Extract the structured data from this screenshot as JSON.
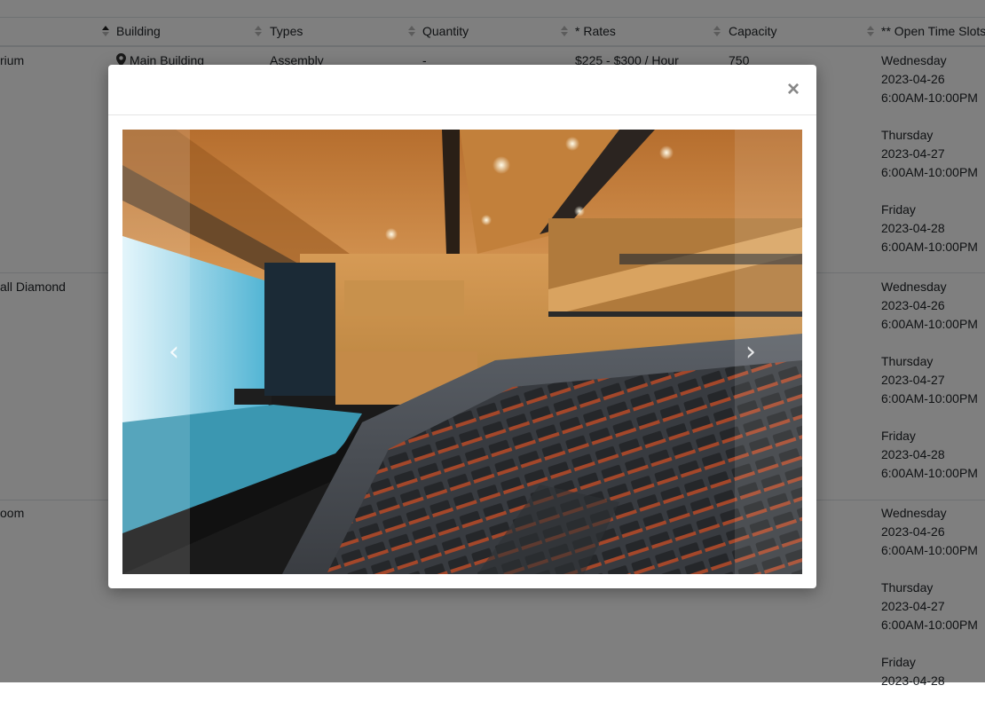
{
  "table": {
    "headers": [
      {
        "label": "Building",
        "sorted": true
      },
      {
        "label": "Types",
        "sorted": false
      },
      {
        "label": "Quantity",
        "sorted": false
      },
      {
        "label": "* Rates",
        "sorted": false
      },
      {
        "label": "Capacity",
        "sorted": false
      },
      {
        "label": "** Open Time Slots",
        "sorted": false
      }
    ],
    "rows": [
      {
        "name": "rium",
        "building": "Main Building",
        "type": "Assembly",
        "quantity": "-",
        "rates": "$225 - $300 / Hour",
        "capacity": "750",
        "slots": [
          {
            "day": "Wednesday",
            "date": "2023-04-26",
            "time": "6:00AM-10:00PM"
          },
          {
            "day": "Thursday",
            "date": "2023-04-27",
            "time": "6:00AM-10:00PM"
          },
          {
            "day": "Friday",
            "date": "2023-04-28",
            "time": "6:00AM-10:00PM"
          }
        ]
      },
      {
        "name": "all Diamond",
        "slots": [
          {
            "day": "Wednesday",
            "date": "2023-04-26",
            "time": "6:00AM-10:00PM"
          },
          {
            "day": "Thursday",
            "date": "2023-04-27",
            "time": "6:00AM-10:00PM"
          },
          {
            "day": "Friday",
            "date": "2023-04-28",
            "time": "6:00AM-10:00PM"
          }
        ]
      },
      {
        "name": "oom",
        "slots": [
          {
            "day": "Wednesday",
            "date": "2023-04-26",
            "time": "6:00AM-10:00PM"
          },
          {
            "day": "Thursday",
            "date": "2023-04-27",
            "time": "6:00AM-10:00PM"
          },
          {
            "day": "Friday",
            "date": "2023-04-28",
            "time": ""
          }
        ]
      }
    ]
  },
  "modal": {
    "close_label": "×",
    "prev_label": "‹",
    "next_label": "›",
    "image_alt": "Auditorium interior photo"
  },
  "colors": {
    "backdrop": "#000000",
    "wood": "#c98a3e",
    "seat_frame": "#a4472a",
    "seat": "#2d2f31",
    "stage_screen": "#8fd3e8"
  },
  "icons": {
    "building": "map-pin-icon",
    "sort": "sort-icon",
    "close": "close-icon",
    "prev": "chevron-left-icon",
    "next": "chevron-right-icon"
  }
}
